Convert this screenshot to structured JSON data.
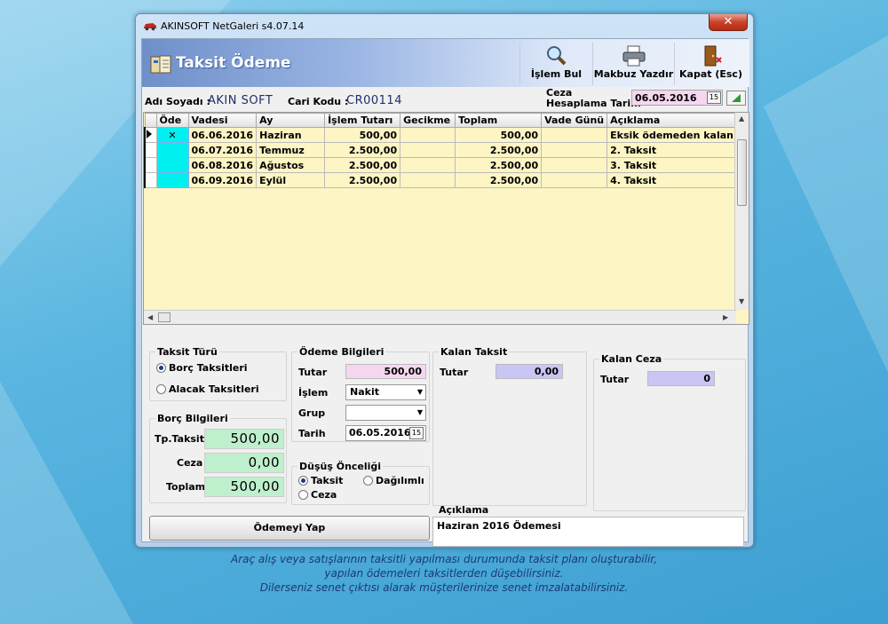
{
  "window": {
    "title": "AKINSOFT NetGaleri s4.07.14",
    "close": "✕"
  },
  "header": {
    "title": "Taksit Ödeme"
  },
  "toolbar": {
    "search_label": "İşlem Bul",
    "print_label": "Makbuz Yazdır",
    "close_label": "Kapat (Esc)"
  },
  "info": {
    "name_label": "Adı Soyadı :",
    "name_value": "AKIN  SOFT",
    "code_label": "Cari Kodu :",
    "code_value": "CR00114",
    "penalty_date_label_1": "Ceza",
    "penalty_date_label_2": "Hesaplama Tarihi",
    "penalty_date_value": "06.05.2016"
  },
  "grid": {
    "columns": [
      "Öde",
      "Vadesi",
      "Ay",
      "İşlem Tutarı",
      "Gecikme",
      "Toplam",
      "Vade Günü",
      "Açıklama"
    ],
    "rows": [
      {
        "ode": "✕",
        "vade": "06.06.2016",
        "ay": "Haziran",
        "tutar": "500,00",
        "gecikme": "",
        "toplam": "500,00",
        "gun": "",
        "aciklama": "Eksik ödemeden kalan"
      },
      {
        "ode": "",
        "vade": "06.07.2016",
        "ay": "Temmuz",
        "tutar": "2.500,00",
        "gecikme": "",
        "toplam": "2.500,00",
        "gun": "",
        "aciklama": "2. Taksit"
      },
      {
        "ode": "",
        "vade": "06.08.2016",
        "ay": "Ağustos",
        "tutar": "2.500,00",
        "gecikme": "",
        "toplam": "2.500,00",
        "gun": "",
        "aciklama": "3. Taksit"
      },
      {
        "ode": "",
        "vade": "06.09.2016",
        "ay": "Eylül",
        "tutar": "2.500,00",
        "gecikme": "",
        "toplam": "2.500,00",
        "gun": "",
        "aciklama": "4. Taksit"
      }
    ]
  },
  "taksit_turu": {
    "title": "Taksit Türü",
    "opt1": "Borç Taksitleri",
    "opt2": "Alacak Taksitleri"
  },
  "borc_bilgileri": {
    "title": "Borç Bilgileri",
    "tp_label": "Tp.Taksit",
    "tp_value": "500,00",
    "ceza_label": "Ceza",
    "ceza_value": "0,00",
    "toplam_label": "Toplam",
    "toplam_value": "500,00"
  },
  "odeme_bilgileri": {
    "title": "Ödeme Bilgileri",
    "tutar_label": "Tutar",
    "tutar_value": "500,00",
    "islem_label": "İşlem",
    "islem_value": "Nakit",
    "grup_label": "Grup",
    "grup_value": "",
    "tarih_label": "Tarih",
    "tarih_value": "06.05.2016"
  },
  "dusus": {
    "title": "Düşüş Önceliği",
    "opt1": "Taksit",
    "opt2": "Dağılımlı",
    "opt3": "Ceza"
  },
  "kalan_taksit": {
    "title": "Kalan Taksit",
    "tutar_label": "Tutar",
    "tutar_value": "0,00"
  },
  "kalan_ceza": {
    "title": "Kalan Ceza",
    "tutar_label": "Tutar",
    "tutar_value": "0"
  },
  "aciklama": {
    "title": "Açıklama",
    "value": "Haziran 2016  Ödemesi"
  },
  "pay_button": "Ödemeyi Yap",
  "caption": {
    "line1": "Araç alış veya satışlarının taksitli yapılması durumunda taksit planı oluşturabilir,",
    "line2": "yapılan ödemeleri taksitlerden düşebilirsiniz.",
    "line3": "Dilerseniz senet çıktısı alarak müşterilerinize senet imzalatabilirsiniz."
  }
}
